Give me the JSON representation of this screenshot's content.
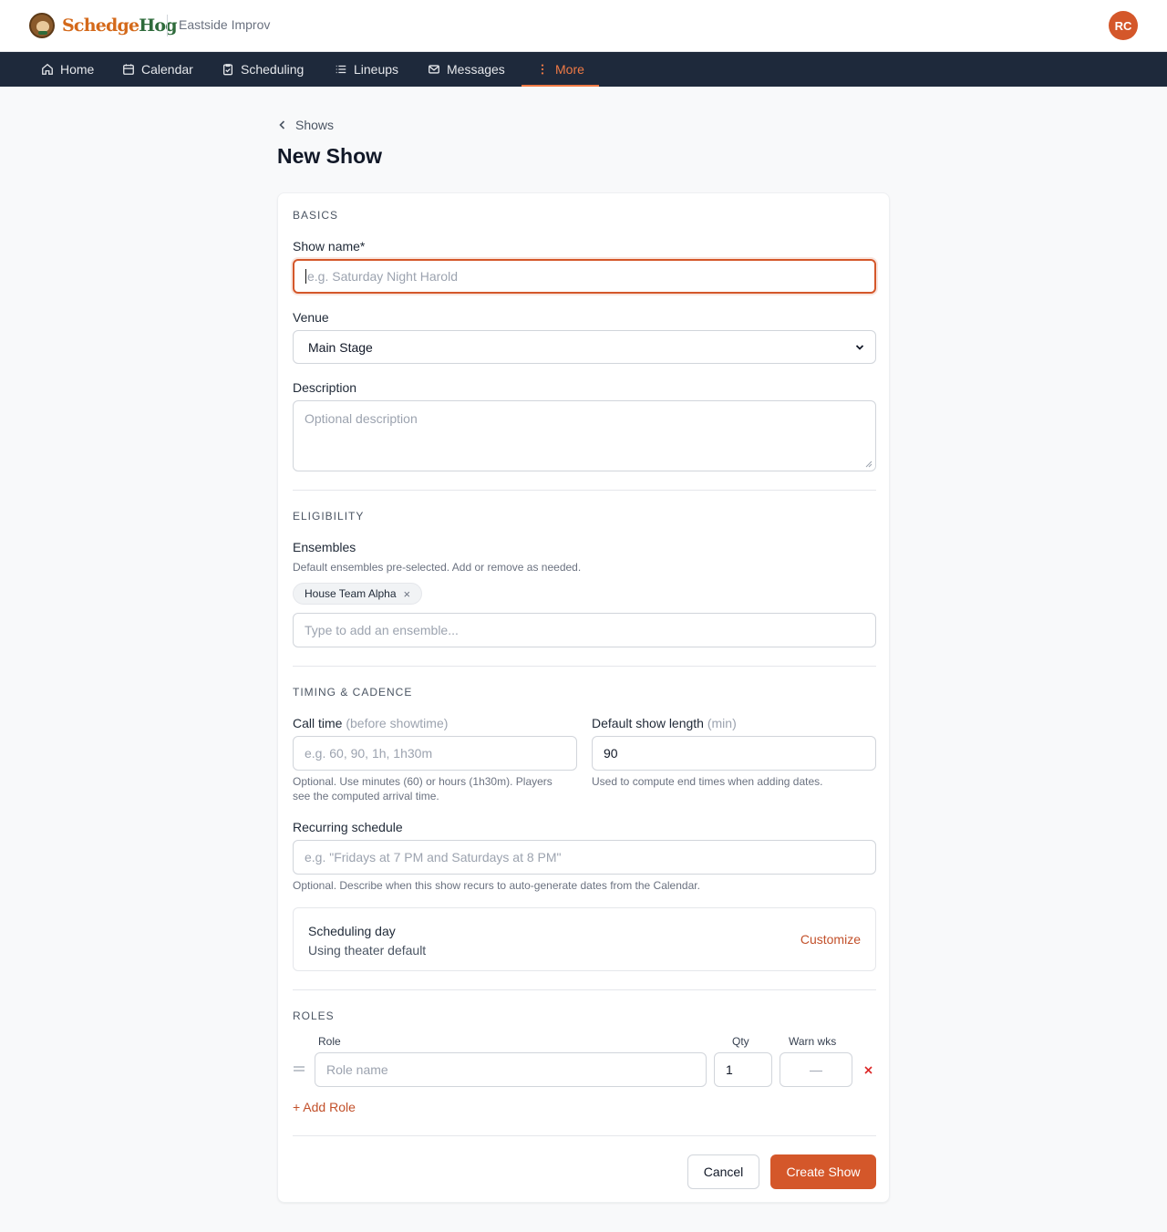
{
  "header": {
    "brand_part1": "Schedge",
    "brand_part2": "Hog",
    "theater_name": "Eastside Improv",
    "avatar_initials": "RC",
    "accent_color": "#d4572a"
  },
  "nav": {
    "items": [
      {
        "label": "Home",
        "icon": "home-icon"
      },
      {
        "label": "Calendar",
        "icon": "calendar-icon"
      },
      {
        "label": "Scheduling",
        "icon": "clipboard-check-icon"
      },
      {
        "label": "Lineups",
        "icon": "list-icon"
      },
      {
        "label": "Messages",
        "icon": "mail-icon"
      },
      {
        "label": "More",
        "icon": "more-vertical-icon",
        "active": true
      }
    ]
  },
  "breadcrumb": {
    "back_label": "Shows"
  },
  "page": {
    "title": "New Show"
  },
  "basics": {
    "heading": "Basics",
    "show_name_label": "Show name*",
    "show_name_placeholder": "e.g. Saturday Night Harold",
    "venue_label": "Venue",
    "venue_value": "Main Stage",
    "description_label": "Description",
    "description_placeholder": "Optional description"
  },
  "eligibility": {
    "heading": "Eligibility",
    "ensembles_label": "Ensembles",
    "ensembles_hint": "Default ensembles pre-selected. Add or remove as needed.",
    "selected": [
      "House Team Alpha"
    ],
    "add_placeholder": "Type to add an ensemble..."
  },
  "timing": {
    "heading": "Timing & Cadence",
    "call_time_label": "Call time",
    "call_time_sub": "(before showtime)",
    "call_time_placeholder": "e.g. 60, 90, 1h, 1h30m",
    "call_time_hint_1": "Optional. Use minutes (60) or hours (1h30m). Players",
    "call_time_hint_2": "see the computed arrival time.",
    "length_label": "Default show length",
    "length_sub": "(min)",
    "length_value": "90",
    "length_hint": "Used to compute end times when adding dates.",
    "recurring_label": "Recurring schedule",
    "recurring_placeholder": "e.g. \"Fridays at 7 PM and Saturdays at 8 PM\"",
    "recurring_hint": "Optional. Describe when this show recurs to auto-generate dates from the Calendar.",
    "scheduling_day_title": "Scheduling day",
    "scheduling_day_value": "Using theater default",
    "customize_label": "Customize"
  },
  "roles": {
    "heading": "Roles",
    "col_role": "Role",
    "col_qty": "Qty",
    "col_warn": "Warn wks",
    "rows": [
      {
        "name_placeholder": "Role name",
        "qty": "1",
        "warn_placeholder": "—"
      }
    ],
    "add_label": "+ Add Role"
  },
  "actions": {
    "cancel_label": "Cancel",
    "create_label": "Create Show"
  }
}
